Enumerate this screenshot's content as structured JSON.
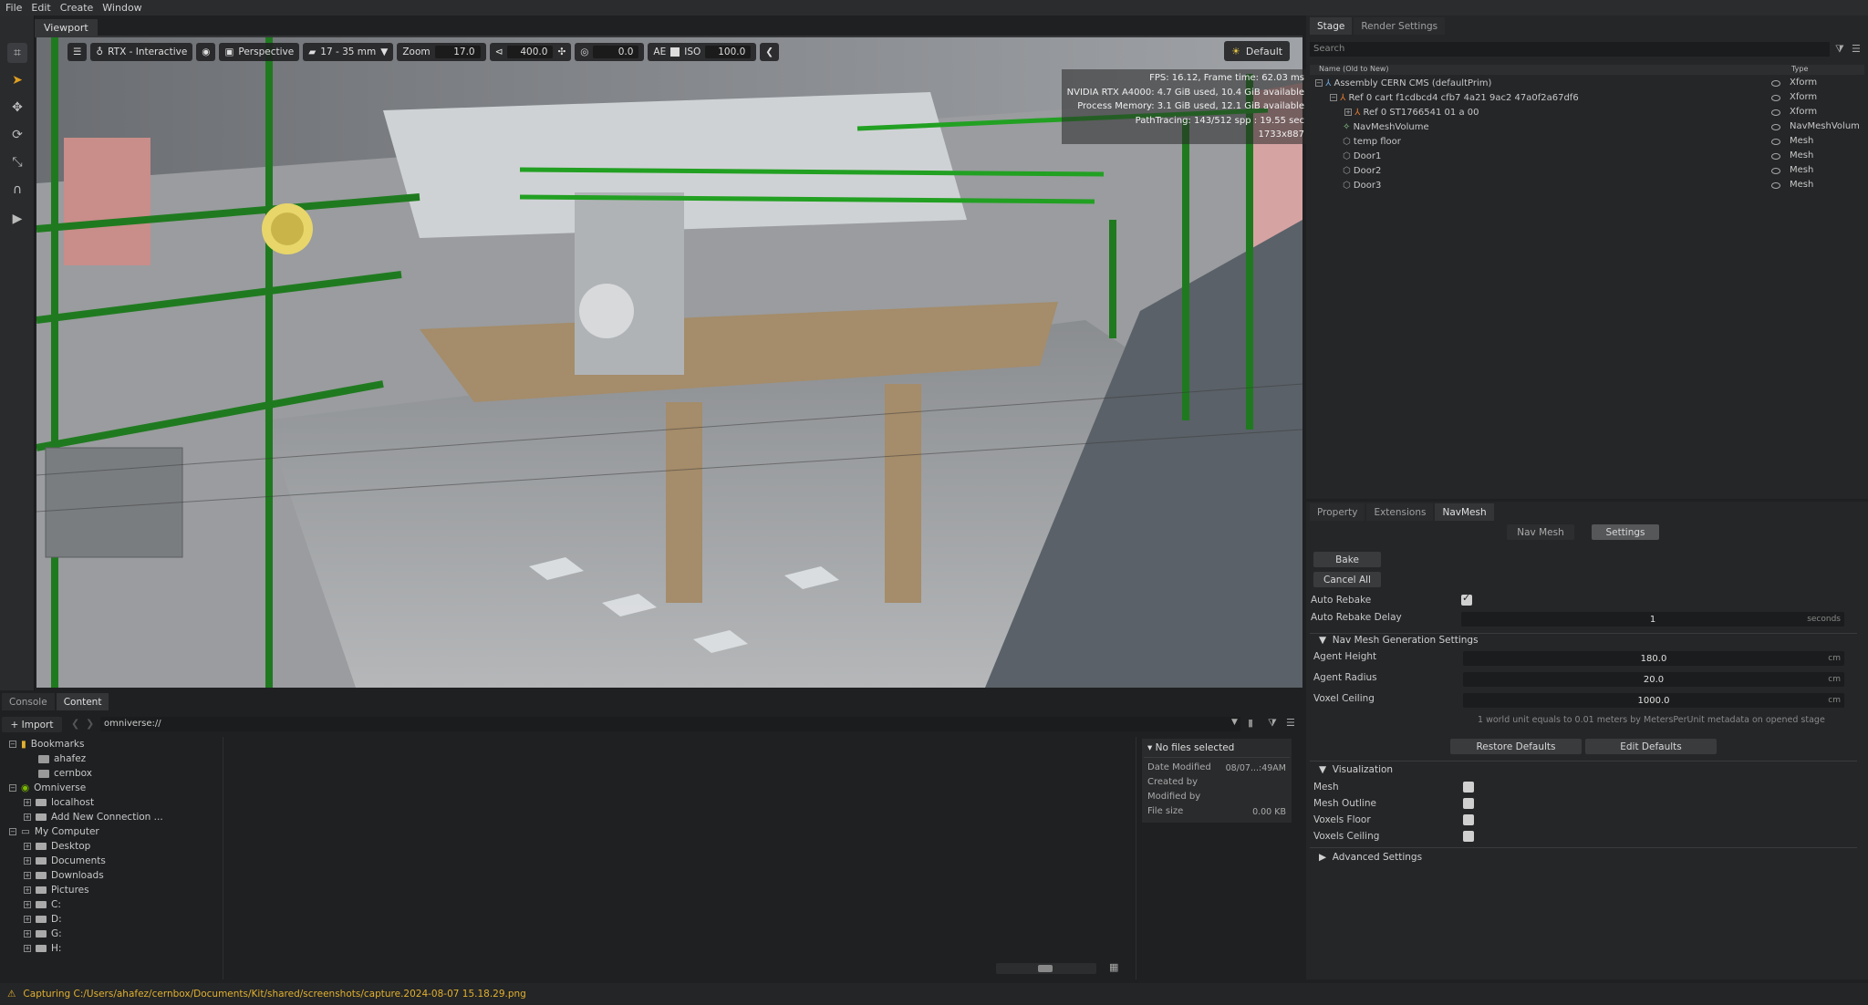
{
  "menubar": {
    "items": [
      "File",
      "Edit",
      "Create",
      "Window"
    ]
  },
  "viewport": {
    "tab_label": "Viewport",
    "toolbar": {
      "renderer": "RTX - Interactive",
      "camera": "Perspective",
      "lens": "17 - 35 mm",
      "zoom_label": "Zoom",
      "zoom_value": "17.0",
      "speed_value": "400.0",
      "exposure_value": "0.0",
      "ae_label": "AE",
      "iso_label": "ISO",
      "iso_value": "100.0"
    },
    "lighting": "Default",
    "stats": {
      "fps": "FPS: 16.12, Frame time: 62.03 ms",
      "gpu": "NVIDIA RTX A4000: 4.7 GiB used, 10.4 GiB available",
      "memory": "Process Memory: 3.1 GiB used, 12.1 GiB available",
      "pathtracing": "PathTracing: 143/512 spp : 19.55 sec",
      "resolution": "1733x887"
    }
  },
  "stage": {
    "tabs": [
      "Stage",
      "Render Settings"
    ],
    "search_placeholder": "Search",
    "col_name": "Name (Old to New)",
    "col_type": "Type",
    "items": [
      {
        "name": "Assembly  CERN CMS (defaultPrim)",
        "type": "Xform"
      },
      {
        "name": "Ref 0  cart  f1cdbcd4  cfb7  4a21  9ac2  47a0f2a67df6",
        "type": "Xform"
      },
      {
        "name": "Ref 0  ST1766541  01  a  00",
        "type": "Xform"
      },
      {
        "name": "NavMeshVolume",
        "type": "NavMeshVolum"
      },
      {
        "name": "temp floor",
        "type": "Mesh"
      },
      {
        "name": "Door1",
        "type": "Mesh"
      },
      {
        "name": "Door2",
        "type": "Mesh"
      },
      {
        "name": "Door3",
        "type": "Mesh"
      }
    ]
  },
  "props": {
    "tabs": [
      "Property",
      "Extensions",
      "NavMesh"
    ],
    "subtabs": [
      "Nav Mesh",
      "Settings"
    ],
    "bake": "Bake",
    "cancel_all": "Cancel All",
    "auto_rebake": "Auto Rebake",
    "auto_rebake_delay": "Auto Rebake Delay",
    "delay_value": "1",
    "delay_unit": "seconds",
    "gen_section": "Nav Mesh Generation Settings",
    "agent_height_label": "Agent Height",
    "agent_height": "180.0",
    "agent_radius_label": "Agent Radius",
    "agent_radius": "20.0",
    "voxel_ceiling_label": "Voxel Ceiling",
    "voxel_ceiling": "1000.0",
    "unit_cm": "cm",
    "unit_note": "1 world unit equals to 0.01 meters by MetersPerUnit metadata on opened stage",
    "restore_defaults": "Restore Defaults",
    "edit_defaults": "Edit Defaults",
    "vis_section": "Visualization",
    "vis_mesh": "Mesh",
    "vis_outline": "Mesh Outline",
    "vis_floor": "Voxels Floor",
    "vis_ceiling": "Voxels Ceiling",
    "advanced": "Advanced Settings"
  },
  "content": {
    "tabs": [
      "Console",
      "Content"
    ],
    "import": "Import",
    "path": "omniverse://",
    "tree": {
      "bookmarks": "Bookmarks",
      "ahafez": "ahafez",
      "cernbox": "cernbox",
      "omniverse": "Omniverse",
      "localhost": "localhost",
      "add_connection": "Add New Connection ...",
      "my_computer": "My Computer",
      "desktop": "Desktop",
      "documents": "Documents",
      "downloads": "Downloads",
      "pictures": "Pictures",
      "c": "C:",
      "d": "D:",
      "g": "G:",
      "h": "H:"
    },
    "info": {
      "title": "No files selected",
      "date_modified": "Date Modified",
      "date_value": "08/07...:49AM",
      "created_by": "Created by",
      "modified_by": "Modified by",
      "file_size": "File size",
      "size_value": "0.00 KB"
    }
  },
  "status": {
    "message": "Capturing C:/Users/ahafez/cernbox/Documents/Kit/shared/screenshots/capture.2024-08-07 15.18.29.png"
  }
}
